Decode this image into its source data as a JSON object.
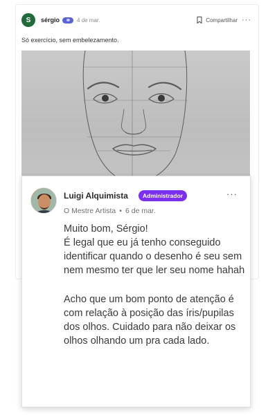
{
  "post": {
    "author": "sérgio",
    "avatar_initial": "S",
    "date": "4 de mar.",
    "share_label": "Compartilhar",
    "more_icon": "···",
    "text": "Só exercício, sem embelezamento."
  },
  "reply": {
    "author": "Luigi Alquimista",
    "badge": "Administrador",
    "subtitle": "O Mestre Artista",
    "date": "6 de mar.",
    "more_icon": "···",
    "paragraphs": [
      "Muito bom, Sérgio!\nÉ legal que eu já tenho conseguido identificar quando o desenho é seu sem nem mesmo ter que ler seu nome hahah",
      "Acho que um bom ponto de atenção é com relação à posição das íris/pupilas dos olhos. Cuidado para não deixar os olhos olhando um pra cada lado."
    ]
  },
  "colors": {
    "post_avatar": "#1f6b3a",
    "badge_bg": "#7d2ff0",
    "role_badge": "#5a63d6"
  }
}
